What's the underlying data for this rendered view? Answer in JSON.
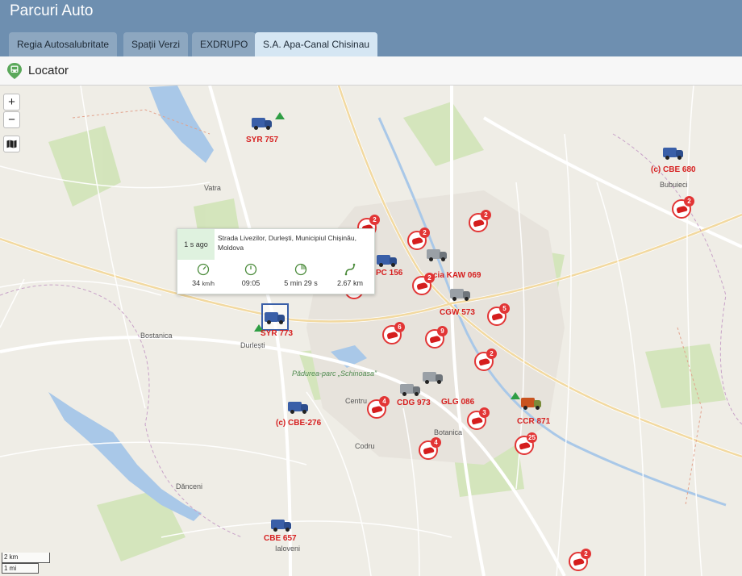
{
  "app": {
    "title": "Parcuri Auto"
  },
  "tabs": [
    {
      "label": "Regia Autosalubritate",
      "active": false
    },
    {
      "label": "Spații Verzi",
      "active": false
    },
    {
      "label": "EXDRUPO",
      "active": false
    },
    {
      "label": "S.A. Apa-Canal Chisinau",
      "active": true
    }
  ],
  "section": {
    "title": "Locator",
    "icon": "bus-pin-icon"
  },
  "map_controls": {
    "zoom_in": "+",
    "zoom_out": "−",
    "layers_icon": "map-layers-icon"
  },
  "vehicles": [
    {
      "label": "SYR 757",
      "kind": "truck"
    },
    {
      "label": "(c) CBE 680",
      "kind": "truck"
    },
    {
      "label": "SYR 773",
      "kind": "truck",
      "selected": true
    },
    {
      "label": "PC 156",
      "kind": "truck"
    },
    {
      "label": "cia KAW 069",
      "kind": "car"
    },
    {
      "label": "CGW 573",
      "kind": "truck"
    },
    {
      "label": "CDG 973",
      "kind": "truck"
    },
    {
      "label": "GLG 086",
      "kind": "truck"
    },
    {
      "label": "CCR 871",
      "kind": "truck"
    },
    {
      "label": "(c) CBE-276",
      "kind": "truck"
    },
    {
      "label": "CBE 657",
      "kind": "truck"
    }
  ],
  "clusters": [
    "2",
    "2",
    "2",
    "2",
    "2",
    "5",
    "6",
    "9",
    "2",
    "4",
    "3",
    "4",
    "25",
    "2",
    "2"
  ],
  "popup": {
    "ago": "1 s ago",
    "address": "Strada Livezilor, Durlești, Municipiul Chișinău, Moldova",
    "stats": [
      {
        "icon": "speedometer-icon",
        "value": "34",
        "unit": "km/h"
      },
      {
        "icon": "clock-icon",
        "value": "09:05",
        "unit": ""
      },
      {
        "icon": "duration-icon",
        "value": "5 min 29 s",
        "unit": ""
      },
      {
        "icon": "distance-icon",
        "value": "2.67 km",
        "unit": ""
      }
    ]
  },
  "places": [
    "Vatra",
    "Durlești",
    "Codru",
    "Ialoveni",
    "Dănceni",
    "Bubuieci",
    "Pădurea-parc „Schinoasa”",
    "Bostanica",
    "Botanica",
    "Centru"
  ],
  "scale": {
    "metric": "2 km",
    "imperial": "1 mi"
  },
  "colors": {
    "header": "#6e8fb0",
    "tab_active": "#d5e6f3",
    "marker_red": "#d61f1f",
    "water": "#a9c8e8",
    "park": "#cfe3b4"
  }
}
